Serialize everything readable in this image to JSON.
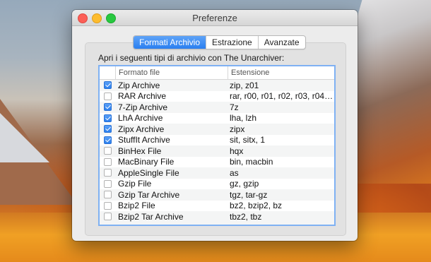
{
  "window": {
    "title": "Preferenze"
  },
  "tabs": [
    {
      "label": "Formati Archivio",
      "active": true
    },
    {
      "label": "Estrazione",
      "active": false
    },
    {
      "label": "Avanzate",
      "active": false
    }
  ],
  "panel": {
    "caption": "Apri i seguenti tipi di archivio con The Unarchiver:"
  },
  "table": {
    "headers": {
      "format": "Formato file",
      "extension": "Estensione"
    },
    "rows": [
      {
        "checked": true,
        "format": "Zip Archive",
        "extension": "zip, z01"
      },
      {
        "checked": false,
        "format": "RAR Archive",
        "extension": "rar, r00, r01, r02, r03, r04, r0..."
      },
      {
        "checked": true,
        "format": "7-Zip Archive",
        "extension": "7z"
      },
      {
        "checked": true,
        "format": "LhA Archive",
        "extension": "lha, lzh"
      },
      {
        "checked": true,
        "format": "Zipx Archive",
        "extension": "zipx"
      },
      {
        "checked": true,
        "format": "StuffIt Archive",
        "extension": "sit, sitx, 1"
      },
      {
        "checked": false,
        "format": "BinHex File",
        "extension": "hqx"
      },
      {
        "checked": false,
        "format": "MacBinary File",
        "extension": "bin, macbin"
      },
      {
        "checked": false,
        "format": "AppleSingle File",
        "extension": "as"
      },
      {
        "checked": false,
        "format": "Gzip File",
        "extension": "gz, gzip"
      },
      {
        "checked": false,
        "format": "Gzip Tar Archive",
        "extension": "tgz, tar-gz"
      },
      {
        "checked": false,
        "format": "Bzip2 File",
        "extension": "bz2, bzip2, bz"
      },
      {
        "checked": false,
        "format": "Bzip2 Tar Archive",
        "extension": "tbz2, tbz"
      }
    ]
  },
  "colors": {
    "accent": "#2a7ff0",
    "close": "#fc5f57",
    "minimize": "#fdbc2e",
    "maximize": "#28c840"
  }
}
